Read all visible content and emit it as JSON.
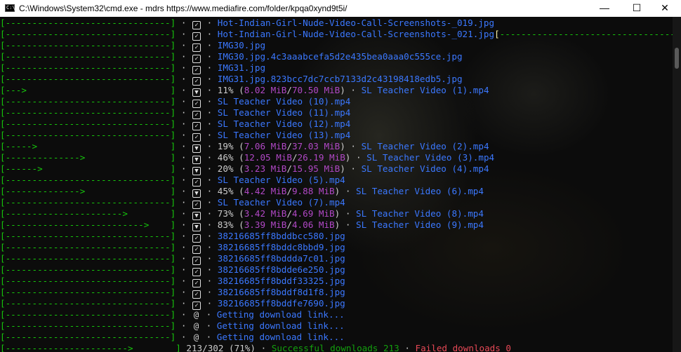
{
  "window": {
    "title": "C:\\Windows\\System32\\cmd.exe - mdrs  https://www.mediafire.com/folder/kpqa0xynd9t5i/",
    "icon": "cmd-icon",
    "icon_text": "C:\\",
    "minimize_label": "—",
    "maximize_label": "☐",
    "close_label": "✕"
  },
  "console": {
    "rows": [
      {
        "bar": "[-------------------------------]",
        "state": "done",
        "text": "Hot-Indian-Girl-Nude-Video-Call-Screenshots-_019.jpg"
      },
      {
        "bar": "[-------------------------------]",
        "state": "done",
        "text": "Hot-Indian-Girl-Nude-Video-Call-Screenshots-_021.jpg",
        "trail": "[",
        "trail_bar": "---------------------------------------------------"
      },
      {
        "bar": "[-------------------------------]",
        "state": "done",
        "text": "IMG30.jpg"
      },
      {
        "bar": "[-------------------------------]",
        "state": "done",
        "text": "IMG30.jpg.4c3aaabcefa5d2e435bea0aaa0c555ce.jpg"
      },
      {
        "bar": "[-------------------------------]",
        "state": "done",
        "text": "IMG31.jpg"
      },
      {
        "bar": "[-------------------------------]",
        "state": "done",
        "text": "IMG31.jpg.823bcc7dc7ccb7133d2c43198418edb5.jpg"
      },
      {
        "bar": "[--->                           ]",
        "state": "progress",
        "percent": "11%",
        "done": "8.02 MiB",
        "total": "70.50 MiB",
        "text": "SL Teacher Video (1).mp4"
      },
      {
        "bar": "[-------------------------------]",
        "state": "done",
        "text": "SL Teacher Video (10).mp4"
      },
      {
        "bar": "[-------------------------------]",
        "state": "done",
        "text": "SL Teacher Video (11).mp4"
      },
      {
        "bar": "[-------------------------------]",
        "state": "done",
        "text": "SL Teacher Video (12).mp4"
      },
      {
        "bar": "[-------------------------------]",
        "state": "done",
        "text": "SL Teacher Video (13).mp4"
      },
      {
        "bar": "[----->                         ]",
        "state": "progress",
        "percent": "19%",
        "done": "7.06 MiB",
        "total": "37.03 MiB",
        "text": "SL Teacher Video (2).mp4"
      },
      {
        "bar": "[-------------->                ]",
        "state": "progress",
        "percent": "46%",
        "done": "12.05 MiB",
        "total": "26.19 MiB",
        "text": "SL Teacher Video (3).mp4"
      },
      {
        "bar": "[------>                        ]",
        "state": "progress",
        "percent": "20%",
        "done": "3.23 MiB",
        "total": "15.95 MiB",
        "text": "SL Teacher Video (4).mp4"
      },
      {
        "bar": "[-------------------------------]",
        "state": "done",
        "text": "SL Teacher Video (5).mp4"
      },
      {
        "bar": "[-------------->                ]",
        "state": "progress",
        "percent": "45%",
        "done": "4.42 MiB",
        "total": "9.88 MiB",
        "text": "SL Teacher Video (6).mp4"
      },
      {
        "bar": "[-------------------------------]",
        "state": "done",
        "text": "SL Teacher Video (7).mp4"
      },
      {
        "bar": "[---------------------->        ]",
        "state": "progress",
        "percent": "73%",
        "done": "3.42 MiB",
        "total": "4.69 MiB",
        "text": "SL Teacher Video (8).mp4"
      },
      {
        "bar": "[-------------------------->    ]",
        "state": "progress",
        "percent": "83%",
        "done": "3.39 MiB",
        "total": "4.06 MiB",
        "text": "SL Teacher Video (9).mp4"
      },
      {
        "bar": "[-------------------------------]",
        "state": "done",
        "text": "38216685ff8bddbcc580.jpg"
      },
      {
        "bar": "[-------------------------------]",
        "state": "done",
        "text": "38216685ff8bddc8bbd9.jpg"
      },
      {
        "bar": "[-------------------------------]",
        "state": "done",
        "text": "38216685ff8bddda7c01.jpg"
      },
      {
        "bar": "[-------------------------------]",
        "state": "done",
        "text": "38216685ff8bdde6e250.jpg"
      },
      {
        "bar": "[-------------------------------]",
        "state": "done",
        "text": "38216685ff8bddf33325.jpg"
      },
      {
        "bar": "[-------------------------------]",
        "state": "done",
        "text": "38216685ff8bddf8d1f8.jpg"
      },
      {
        "bar": "[-------------------------------]",
        "state": "done",
        "text": "38216685ff8bddfe7690.jpg"
      },
      {
        "bar": "[-------------------------------]",
        "state": "pending",
        "text": "Getting download link..."
      },
      {
        "bar": "[-------------------------------]",
        "state": "pending",
        "text": "Getting download link..."
      },
      {
        "bar": "[-------------------------------]",
        "state": "pending",
        "text": "Getting download link..."
      }
    ],
    "summary": {
      "bar": "[----------------------->        ]",
      "count": "213/302 (71%)",
      "success": "Successful downloads 213",
      "failed": "Failed downloads 0"
    },
    "separator": "·",
    "checkbox_glyph": "✓",
    "progress_glyph": "▼",
    "spinner_glyph": "@"
  },
  "colors": {
    "bar": "#16c60c",
    "file_name": "#3b78ff",
    "size": "#b148c6",
    "success": "#13a10e",
    "failed": "#e74856"
  }
}
